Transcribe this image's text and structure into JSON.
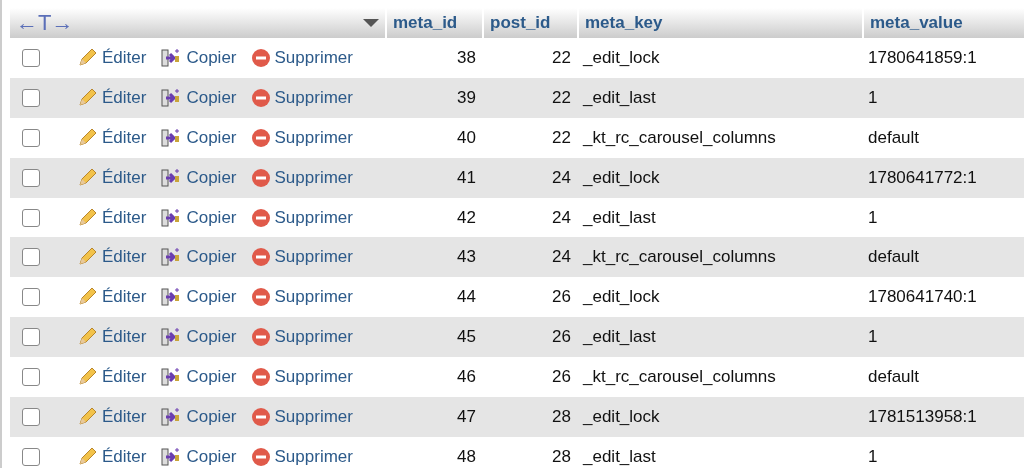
{
  "table": {
    "toggle_header": "←T→",
    "columns": [
      "meta_id",
      "post_id",
      "meta_key",
      "meta_value"
    ],
    "rows": [
      {
        "selected": false,
        "edit": "Éditer",
        "copy": "Copier",
        "delete": "Supprimer",
        "cells": [
          "38",
          "22",
          "_edit_lock",
          "1780641859:1"
        ]
      },
      {
        "selected": false,
        "edit": "Éditer",
        "copy": "Copier",
        "delete": "Supprimer",
        "cells": [
          "39",
          "22",
          "_edit_last",
          "1"
        ]
      },
      {
        "selected": false,
        "edit": "Éditer",
        "copy": "Copier",
        "delete": "Supprimer",
        "cells": [
          "40",
          "22",
          "_kt_rc_carousel_columns",
          "default"
        ]
      },
      {
        "selected": false,
        "edit": "Éditer",
        "copy": "Copier",
        "delete": "Supprimer",
        "cells": [
          "41",
          "24",
          "_edit_lock",
          "1780641772:1"
        ]
      },
      {
        "selected": false,
        "edit": "Éditer",
        "copy": "Copier",
        "delete": "Supprimer",
        "cells": [
          "42",
          "24",
          "_edit_last",
          "1"
        ]
      },
      {
        "selected": false,
        "edit": "Éditer",
        "copy": "Copier",
        "delete": "Supprimer",
        "cells": [
          "43",
          "24",
          "_kt_rc_carousel_columns",
          "default"
        ]
      },
      {
        "selected": false,
        "edit": "Éditer",
        "copy": "Copier",
        "delete": "Supprimer",
        "cells": [
          "44",
          "26",
          "_edit_lock",
          "1780641740:1"
        ]
      },
      {
        "selected": false,
        "edit": "Éditer",
        "copy": "Copier",
        "delete": "Supprimer",
        "cells": [
          "45",
          "26",
          "_edit_last",
          "1"
        ]
      },
      {
        "selected": false,
        "edit": "Éditer",
        "copy": "Copier",
        "delete": "Supprimer",
        "cells": [
          "46",
          "26",
          "_kt_rc_carousel_columns",
          "default"
        ]
      },
      {
        "selected": false,
        "edit": "Éditer",
        "copy": "Copier",
        "delete": "Supprimer",
        "cells": [
          "47",
          "28",
          "_edit_lock",
          "1781513958:1"
        ]
      },
      {
        "selected": false,
        "edit": "Éditer",
        "copy": "Copier",
        "delete": "Supprimer",
        "cells": [
          "48",
          "28",
          "_edit_last",
          "1"
        ]
      }
    ]
  }
}
